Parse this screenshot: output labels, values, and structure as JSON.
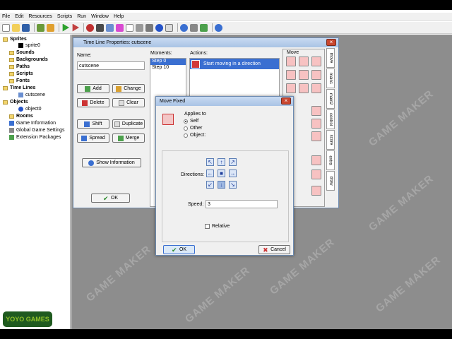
{
  "menu": [
    "File",
    "Edit",
    "Resources",
    "Scripts",
    "Run",
    "Window",
    "Help"
  ],
  "tree": {
    "sprites": "Sprites",
    "sprite0": "sprite0",
    "sounds": "Sounds",
    "backgrounds": "Backgrounds",
    "paths": "Paths",
    "scripts": "Scripts",
    "fonts": "Fonts",
    "timelines": "Time Lines",
    "cutscene": "cutscene",
    "objects": "Objects",
    "object0": "object0",
    "rooms": "Rooms",
    "gameinfo": "Game Information",
    "globalsettings": "Global Game Settings",
    "extensions": "Extension Packages"
  },
  "timeline": {
    "title": "Time Line Properties: cutscene",
    "name_label": "Name:",
    "name_value": "cutscene",
    "moments_label": "Moments:",
    "moments": [
      "Step 0",
      "Step 10"
    ],
    "actions_label": "Actions:",
    "action": "Start moving in a direction",
    "add": "Add",
    "change": "Change",
    "delete": "Delete",
    "clear": "Clear",
    "shift": "Shift",
    "duplicate": "Duplicate",
    "spread": "Spread",
    "merge": "Merge",
    "show_info": "Show Information",
    "ok": "OK",
    "move_tab": "Move",
    "tabs": [
      "move",
      "main1",
      "main2",
      "control",
      "score",
      "extra",
      "draw"
    ]
  },
  "dialog": {
    "title": "Move Fixed",
    "applies_to": "Applies to",
    "self": "Self",
    "other": "Other",
    "object": "Object:",
    "directions_label": "Directions:",
    "speed_label": "Speed:",
    "speed_value": "3",
    "relative": "Relative",
    "ok": "OK",
    "cancel": "Cancel"
  },
  "watermark": "GAME MAKER",
  "logo": "YOYO GAMES",
  "colors": {
    "accent": "#3a6fd1",
    "action_red": "#d23a3a",
    "yoyo_green": "#8fc12a"
  }
}
